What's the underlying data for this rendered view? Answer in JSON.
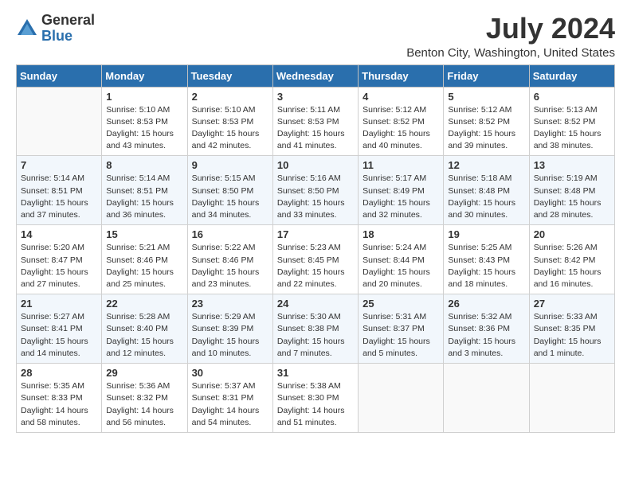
{
  "logo": {
    "general": "General",
    "blue": "Blue"
  },
  "title": "July 2024",
  "subtitle": "Benton City, Washington, United States",
  "days_of_week": [
    "Sunday",
    "Monday",
    "Tuesday",
    "Wednesday",
    "Thursday",
    "Friday",
    "Saturday"
  ],
  "weeks": [
    [
      {
        "day": "",
        "empty": true
      },
      {
        "day": "1",
        "sunrise": "Sunrise: 5:10 AM",
        "sunset": "Sunset: 8:53 PM",
        "daylight": "Daylight: 15 hours and 43 minutes."
      },
      {
        "day": "2",
        "sunrise": "Sunrise: 5:10 AM",
        "sunset": "Sunset: 8:53 PM",
        "daylight": "Daylight: 15 hours and 42 minutes."
      },
      {
        "day": "3",
        "sunrise": "Sunrise: 5:11 AM",
        "sunset": "Sunset: 8:53 PM",
        "daylight": "Daylight: 15 hours and 41 minutes."
      },
      {
        "day": "4",
        "sunrise": "Sunrise: 5:12 AM",
        "sunset": "Sunset: 8:52 PM",
        "daylight": "Daylight: 15 hours and 40 minutes."
      },
      {
        "day": "5",
        "sunrise": "Sunrise: 5:12 AM",
        "sunset": "Sunset: 8:52 PM",
        "daylight": "Daylight: 15 hours and 39 minutes."
      },
      {
        "day": "6",
        "sunrise": "Sunrise: 5:13 AM",
        "sunset": "Sunset: 8:52 PM",
        "daylight": "Daylight: 15 hours and 38 minutes."
      }
    ],
    [
      {
        "day": "7",
        "sunrise": "Sunrise: 5:14 AM",
        "sunset": "Sunset: 8:51 PM",
        "daylight": "Daylight: 15 hours and 37 minutes."
      },
      {
        "day": "8",
        "sunrise": "Sunrise: 5:14 AM",
        "sunset": "Sunset: 8:51 PM",
        "daylight": "Daylight: 15 hours and 36 minutes."
      },
      {
        "day": "9",
        "sunrise": "Sunrise: 5:15 AM",
        "sunset": "Sunset: 8:50 PM",
        "daylight": "Daylight: 15 hours and 34 minutes."
      },
      {
        "day": "10",
        "sunrise": "Sunrise: 5:16 AM",
        "sunset": "Sunset: 8:50 PM",
        "daylight": "Daylight: 15 hours and 33 minutes."
      },
      {
        "day": "11",
        "sunrise": "Sunrise: 5:17 AM",
        "sunset": "Sunset: 8:49 PM",
        "daylight": "Daylight: 15 hours and 32 minutes."
      },
      {
        "day": "12",
        "sunrise": "Sunrise: 5:18 AM",
        "sunset": "Sunset: 8:48 PM",
        "daylight": "Daylight: 15 hours and 30 minutes."
      },
      {
        "day": "13",
        "sunrise": "Sunrise: 5:19 AM",
        "sunset": "Sunset: 8:48 PM",
        "daylight": "Daylight: 15 hours and 28 minutes."
      }
    ],
    [
      {
        "day": "14",
        "sunrise": "Sunrise: 5:20 AM",
        "sunset": "Sunset: 8:47 PM",
        "daylight": "Daylight: 15 hours and 27 minutes."
      },
      {
        "day": "15",
        "sunrise": "Sunrise: 5:21 AM",
        "sunset": "Sunset: 8:46 PM",
        "daylight": "Daylight: 15 hours and 25 minutes."
      },
      {
        "day": "16",
        "sunrise": "Sunrise: 5:22 AM",
        "sunset": "Sunset: 8:46 PM",
        "daylight": "Daylight: 15 hours and 23 minutes."
      },
      {
        "day": "17",
        "sunrise": "Sunrise: 5:23 AM",
        "sunset": "Sunset: 8:45 PM",
        "daylight": "Daylight: 15 hours and 22 minutes."
      },
      {
        "day": "18",
        "sunrise": "Sunrise: 5:24 AM",
        "sunset": "Sunset: 8:44 PM",
        "daylight": "Daylight: 15 hours and 20 minutes."
      },
      {
        "day": "19",
        "sunrise": "Sunrise: 5:25 AM",
        "sunset": "Sunset: 8:43 PM",
        "daylight": "Daylight: 15 hours and 18 minutes."
      },
      {
        "day": "20",
        "sunrise": "Sunrise: 5:26 AM",
        "sunset": "Sunset: 8:42 PM",
        "daylight": "Daylight: 15 hours and 16 minutes."
      }
    ],
    [
      {
        "day": "21",
        "sunrise": "Sunrise: 5:27 AM",
        "sunset": "Sunset: 8:41 PM",
        "daylight": "Daylight: 15 hours and 14 minutes."
      },
      {
        "day": "22",
        "sunrise": "Sunrise: 5:28 AM",
        "sunset": "Sunset: 8:40 PM",
        "daylight": "Daylight: 15 hours and 12 minutes."
      },
      {
        "day": "23",
        "sunrise": "Sunrise: 5:29 AM",
        "sunset": "Sunset: 8:39 PM",
        "daylight": "Daylight: 15 hours and 10 minutes."
      },
      {
        "day": "24",
        "sunrise": "Sunrise: 5:30 AM",
        "sunset": "Sunset: 8:38 PM",
        "daylight": "Daylight: 15 hours and 7 minutes."
      },
      {
        "day": "25",
        "sunrise": "Sunrise: 5:31 AM",
        "sunset": "Sunset: 8:37 PM",
        "daylight": "Daylight: 15 hours and 5 minutes."
      },
      {
        "day": "26",
        "sunrise": "Sunrise: 5:32 AM",
        "sunset": "Sunset: 8:36 PM",
        "daylight": "Daylight: 15 hours and 3 minutes."
      },
      {
        "day": "27",
        "sunrise": "Sunrise: 5:33 AM",
        "sunset": "Sunset: 8:35 PM",
        "daylight": "Daylight: 15 hours and 1 minute."
      }
    ],
    [
      {
        "day": "28",
        "sunrise": "Sunrise: 5:35 AM",
        "sunset": "Sunset: 8:33 PM",
        "daylight": "Daylight: 14 hours and 58 minutes."
      },
      {
        "day": "29",
        "sunrise": "Sunrise: 5:36 AM",
        "sunset": "Sunset: 8:32 PM",
        "daylight": "Daylight: 14 hours and 56 minutes."
      },
      {
        "day": "30",
        "sunrise": "Sunrise: 5:37 AM",
        "sunset": "Sunset: 8:31 PM",
        "daylight": "Daylight: 14 hours and 54 minutes."
      },
      {
        "day": "31",
        "sunrise": "Sunrise: 5:38 AM",
        "sunset": "Sunset: 8:30 PM",
        "daylight": "Daylight: 14 hours and 51 minutes."
      },
      {
        "day": "",
        "empty": true
      },
      {
        "day": "",
        "empty": true
      },
      {
        "day": "",
        "empty": true
      }
    ]
  ]
}
